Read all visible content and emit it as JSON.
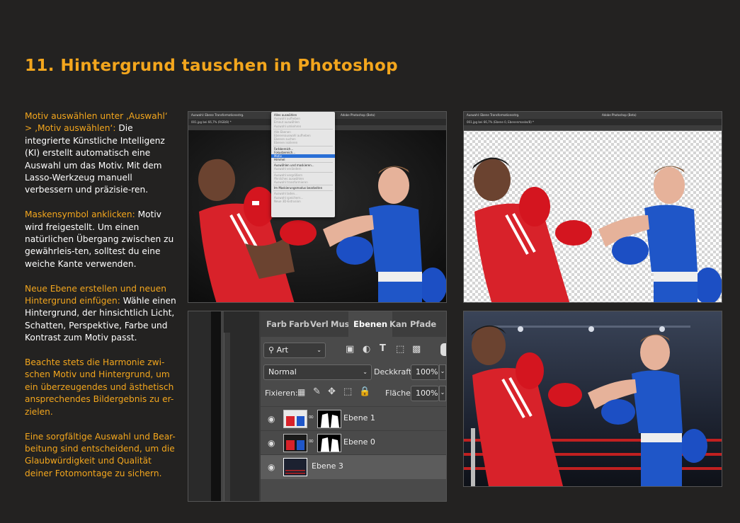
{
  "title": "11. Hintergrund tauschen in Photoshop",
  "paragraphs": [
    {
      "highlight": "Motiv auswählen unter ‚Auswahl‘ > ‚Motiv auswählen‘:",
      "text": " Die integrierte Künstliche Intelligenz (KI) erstellt automatisch eine Auswahl um das Motiv. Mit dem Lasso-Werkzeug manuell verbessern und präzisie-ren."
    },
    {
      "highlight": "Maskensymbol anklicken:",
      "text": " Motiv wird freigestellt. Um einen natürlichen Übergang zwischen zu gewährleis-ten, solltest du eine weiche Kante verwenden."
    },
    {
      "highlight": "Neue Ebene erstellen und neuen Hintergrund einfügen:",
      "text": " Wähle einen Hintergrund, der hinsichtlich Licht, Schatten, Perspektive, Farbe und Kontrast zum Motiv passt."
    },
    {
      "highlight": "Beachte stets die Harmonie zwi-schen Motiv und Hintergrund, um ein überzeugendes und ästhetisch ansprechendes Bildergebnis zu er-zielen.",
      "text": ""
    },
    {
      "highlight": "Eine sorgfältige Auswahl und Bear-beitung sind entscheidend, um die Glaubwürdigkeit und Qualität deiner Fotomontage zu sichern.",
      "text": ""
    }
  ],
  "shot1": {
    "app_title": "Adobe Photoshop (Beta)",
    "doc_tab": "001.jpg bei 66,7% (RGB/8) *",
    "options": "Auswahl: Ebene   Transformationsstrg.",
    "menu_items": [
      {
        "label": "Alles auswählen",
        "state": "normal"
      },
      {
        "label": "Auswahl aufheben",
        "state": "dim"
      },
      {
        "label": "Erneut auswählen",
        "state": "dim"
      },
      {
        "label": "Auswahl umkehren",
        "state": "dim"
      },
      {
        "sep": true
      },
      {
        "label": "Alle Ebenen",
        "state": "dim"
      },
      {
        "label": "Ebenenauswahl aufheben",
        "state": "dim"
      },
      {
        "label": "Ebenen suchen",
        "state": "dim"
      },
      {
        "label": "Ebenen isolieren",
        "state": "dim"
      },
      {
        "sep": true
      },
      {
        "label": "Farbbereich...",
        "state": "normal"
      },
      {
        "label": "Fokusbereich...",
        "state": "normal"
      },
      {
        "label": "Motiv",
        "state": "sel"
      },
      {
        "label": "Himmel",
        "state": "normal"
      },
      {
        "sep": true
      },
      {
        "label": "Auswählen und maskieren...",
        "state": "normal"
      },
      {
        "label": "Auswahl verändern",
        "state": "dim"
      },
      {
        "sep": true
      },
      {
        "label": "Auswahl vergrößern",
        "state": "dim"
      },
      {
        "label": "Ähnliches auswählen",
        "state": "dim"
      },
      {
        "label": "Auswahl transformieren",
        "state": "dim"
      },
      {
        "sep": true
      },
      {
        "label": "Im Maskierungsmodus bearbeiten",
        "state": "normal"
      },
      {
        "sep": true
      },
      {
        "label": "Auswahl laden...",
        "state": "dim"
      },
      {
        "label": "Auswahl speichern...",
        "state": "dim"
      },
      {
        "label": "Neue 3D-Extrusion",
        "state": "dim"
      }
    ]
  },
  "shot2": {
    "app_title": "Adobe Photoshop (Beta)",
    "doc_tab": "001.jpg bei 66,7% (Ebene 0, Ebenenmaske/8) *",
    "options": "Auswahl: Ebene   Transformationsstrg."
  },
  "layers": {
    "tabs": [
      "Farb",
      "Farb",
      "Verl",
      "Mus",
      "Ebenen",
      "Kan",
      "Pfade"
    ],
    "active_tab": "Ebenen",
    "filter": "Art",
    "blend_mode": "Normal",
    "opacity_label": "Deckkraft:",
    "opacity_value": "100%",
    "lock_label": "Fixieren:",
    "fill_label": "Fläche:",
    "fill_value": "100%",
    "items": [
      {
        "name": "Ebene 1",
        "mask": true,
        "active": false
      },
      {
        "name": "Ebene 0",
        "mask": true,
        "active": false
      },
      {
        "name": "Ebene 3",
        "mask": false,
        "active": true
      }
    ]
  },
  "icons": {
    "eye": "eye-icon",
    "search": "search-icon",
    "chain": "chain-link-icon",
    "lock": "lock-icon"
  },
  "colors": {
    "accent": "#f3a61d",
    "background": "#232221"
  }
}
